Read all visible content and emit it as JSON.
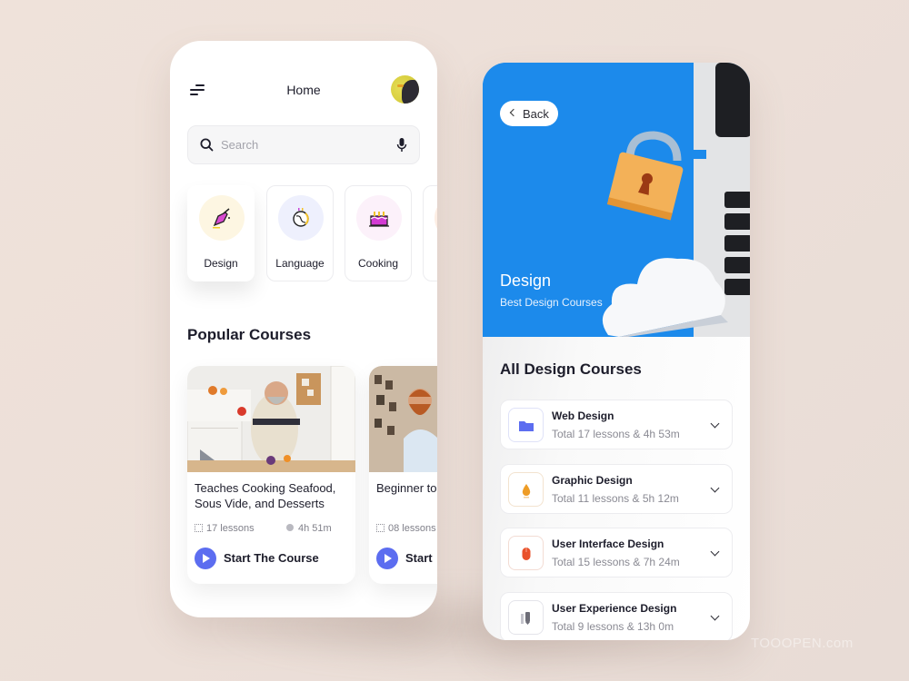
{
  "home": {
    "title": "Home",
    "search": {
      "placeholder": "Search"
    },
    "categories": [
      {
        "label": "Design",
        "icon": "pen-brush-icon",
        "bg": "#fdf6e2",
        "active": true
      },
      {
        "label": "Language",
        "icon": "globe-icon",
        "bg": "#eef0fd",
        "active": false
      },
      {
        "label": "Cooking",
        "icon": "cake-icon",
        "bg": "#fcf1fa",
        "active": false
      }
    ],
    "popular_title": "Popular Courses",
    "courses": [
      {
        "title": "Teaches Cooking Seafood, Sous Vide, and Desserts",
        "lessons": "17 lessons",
        "duration": "4h 51m",
        "cta": "Start The Course"
      },
      {
        "title": "Beginner to Barber NVC",
        "lessons": "08 lessons",
        "duration": "",
        "cta": "Start"
      }
    ]
  },
  "detail": {
    "back_label": "Back",
    "hero_title": "Design",
    "hero_subtitle": "Best Design Courses",
    "list_title": "All Design Courses",
    "items": [
      {
        "title": "Web Design",
        "subtitle": "Total 17 lessons & 4h 53m",
        "icon": "folder-icon",
        "color": "#5c6df0"
      },
      {
        "title": "Graphic Design",
        "subtitle": "Total 11 lessons & 5h 12m",
        "icon": "ink-drop-icon",
        "color": "#ee9c26"
      },
      {
        "title": "User Interface Design",
        "subtitle": "Total 15 lessons & 7h 24m",
        "icon": "mouse-icon",
        "color": "#e9512b"
      },
      {
        "title": "User Experience Design",
        "subtitle": "Total 9 lessons & 13h 0m",
        "icon": "ruler-pencil-icon",
        "color": "#6e6e78"
      }
    ]
  },
  "colors": {
    "accent": "#5c6df0",
    "hero_blue": "#1c8aeb",
    "text": "#1d1d2b"
  },
  "watermark": "TOOOPEN.com"
}
